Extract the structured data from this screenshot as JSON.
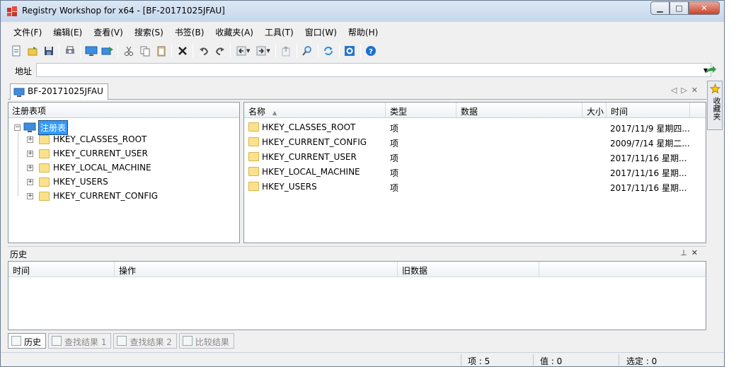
{
  "window": {
    "title": "Registry Workshop for x64 - [BF-20171025JFAU]",
    "buttons": {
      "minimize": "▁",
      "maximize": "□",
      "close": "✕"
    }
  },
  "menu": [
    "文件(F)",
    "编辑(E)",
    "查看(V)",
    "搜索(S)",
    "书签(B)",
    "收藏夹(A)",
    "工具(T)",
    "窗口(W)",
    "帮助(H)"
  ],
  "toolbar": {
    "icons": [
      "new-icon",
      "open-icon",
      "save-icon",
      "print-icon",
      "connect-computer-icon",
      "export-icon",
      "cut-icon",
      "copy-icon",
      "paste-icon",
      "delete-icon",
      "undo-icon",
      "redo-icon",
      "back-icon",
      "forward-icon",
      "up-icon",
      "find-icon",
      "refresh-icon",
      "options-icon",
      "help-icon"
    ]
  },
  "address": {
    "label": "地址",
    "value": ""
  },
  "document_tab": {
    "label": "BF-20171025JFAU"
  },
  "favorites_panel": {
    "label": "收藏夹"
  },
  "tree": {
    "header": "注册表项",
    "root": "注册表",
    "items": [
      "HKEY_CLASSES_ROOT",
      "HKEY_CURRENT_USER",
      "HKEY_LOCAL_MACHINE",
      "HKEY_USERS",
      "HKEY_CURRENT_CONFIG"
    ]
  },
  "list": {
    "columns": {
      "name": "名称",
      "type": "类型",
      "data": "数据",
      "size": "大小",
      "time": "时间"
    },
    "rows": [
      {
        "name": "HKEY_CLASSES_ROOT",
        "type": "项",
        "time": "2017/11/9 星期四..."
      },
      {
        "name": "HKEY_CURRENT_CONFIG",
        "type": "项",
        "time": "2009/7/14 星期二..."
      },
      {
        "name": "HKEY_CURRENT_USER",
        "type": "项",
        "time": "2017/11/16 星期..."
      },
      {
        "name": "HKEY_LOCAL_MACHINE",
        "type": "项",
        "time": "2017/11/16 星期..."
      },
      {
        "name": "HKEY_USERS",
        "type": "项",
        "time": "2017/11/16 星期..."
      }
    ]
  },
  "history": {
    "title": "历史",
    "columns": {
      "time": "时间",
      "operation": "操作",
      "old_data": "旧数据"
    }
  },
  "bottom_tabs": [
    "历史",
    "查找结果 1",
    "查找结果 2",
    "比较结果"
  ],
  "status": {
    "items": "项 : 5",
    "values": "值 : 0",
    "selected": "选定 : 0"
  }
}
